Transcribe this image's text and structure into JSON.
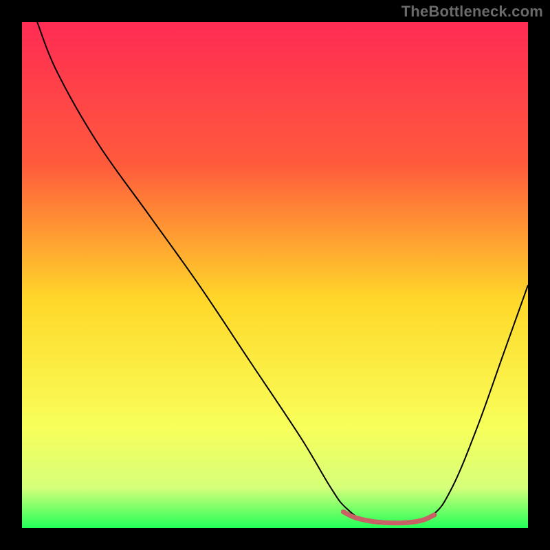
{
  "watermark": "TheBottleneck.com",
  "chart_data": {
    "type": "line",
    "title": "",
    "xlabel": "",
    "ylabel": "",
    "x_range": [
      0,
      100
    ],
    "y_range": [
      0,
      100
    ],
    "gradient_stops": [
      {
        "offset": 0,
        "color": "#ff2b54"
      },
      {
        "offset": 28,
        "color": "#ff5a3c"
      },
      {
        "offset": 55,
        "color": "#ffd829"
      },
      {
        "offset": 80,
        "color": "#f8ff5a"
      },
      {
        "offset": 92,
        "color": "#d6ff7a"
      },
      {
        "offset": 100,
        "color": "#22ff58"
      }
    ],
    "series": [
      {
        "name": "bottleneck-curve",
        "stroke": "#000000",
        "stroke_width": 2,
        "points": [
          {
            "x": 3,
            "y": 100
          },
          {
            "x": 7,
            "y": 90
          },
          {
            "x": 15,
            "y": 76
          },
          {
            "x": 25,
            "y": 62
          },
          {
            "x": 35,
            "y": 48
          },
          {
            "x": 45,
            "y": 33
          },
          {
            "x": 55,
            "y": 18
          },
          {
            "x": 61,
            "y": 8
          },
          {
            "x": 64,
            "y": 4
          },
          {
            "x": 68,
            "y": 1.5
          },
          {
            "x": 75,
            "y": 1.0
          },
          {
            "x": 81,
            "y": 2.5
          },
          {
            "x": 85,
            "y": 8
          },
          {
            "x": 90,
            "y": 20
          },
          {
            "x": 95,
            "y": 34
          },
          {
            "x": 100,
            "y": 48
          }
        ]
      },
      {
        "name": "optimal-segment",
        "stroke": "#c86066",
        "stroke_width": 7,
        "linecap": "round",
        "points": [
          {
            "x": 63.5,
            "y": 3.2
          },
          {
            "x": 66,
            "y": 2.0
          },
          {
            "x": 70,
            "y": 1.2
          },
          {
            "x": 75,
            "y": 1.0
          },
          {
            "x": 79,
            "y": 1.5
          },
          {
            "x": 81.5,
            "y": 2.6
          }
        ]
      }
    ]
  }
}
